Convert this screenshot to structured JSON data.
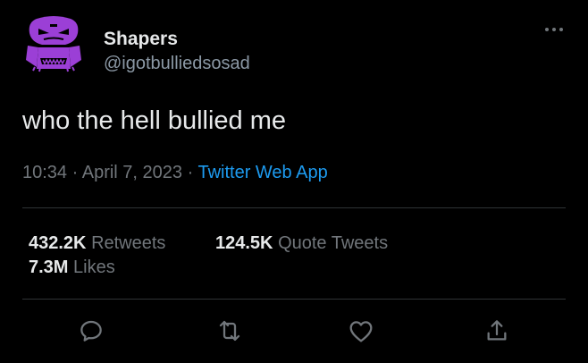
{
  "author": {
    "display_name": "Shapers",
    "handle": "@igotbulliedsosad",
    "avatar_icon": "purple-cartoon-face-avatar"
  },
  "tweet": {
    "text": "who the hell bullied me",
    "time": "10:34",
    "sep1": " · ",
    "date": "April 7, 2023",
    "sep2": " · ",
    "source": "Twitter Web App"
  },
  "stats": {
    "retweets_count": "432.2K",
    "retweets_label": "Retweets",
    "quote_count": "124.5K",
    "quote_label": "Quote Tweets",
    "likes_count": "7.3M",
    "likes_label": "Likes"
  },
  "actions": [
    {
      "name": "reply",
      "icon": "reply-icon"
    },
    {
      "name": "retweet",
      "icon": "retweet-icon"
    },
    {
      "name": "like",
      "icon": "heart-icon"
    },
    {
      "name": "share",
      "icon": "share-icon"
    }
  ],
  "colors": {
    "background": "#000000",
    "text": "#e7e9ea",
    "secondary": "#71767b",
    "link": "#1d9bf0",
    "avatar": "#9b3fd6"
  }
}
